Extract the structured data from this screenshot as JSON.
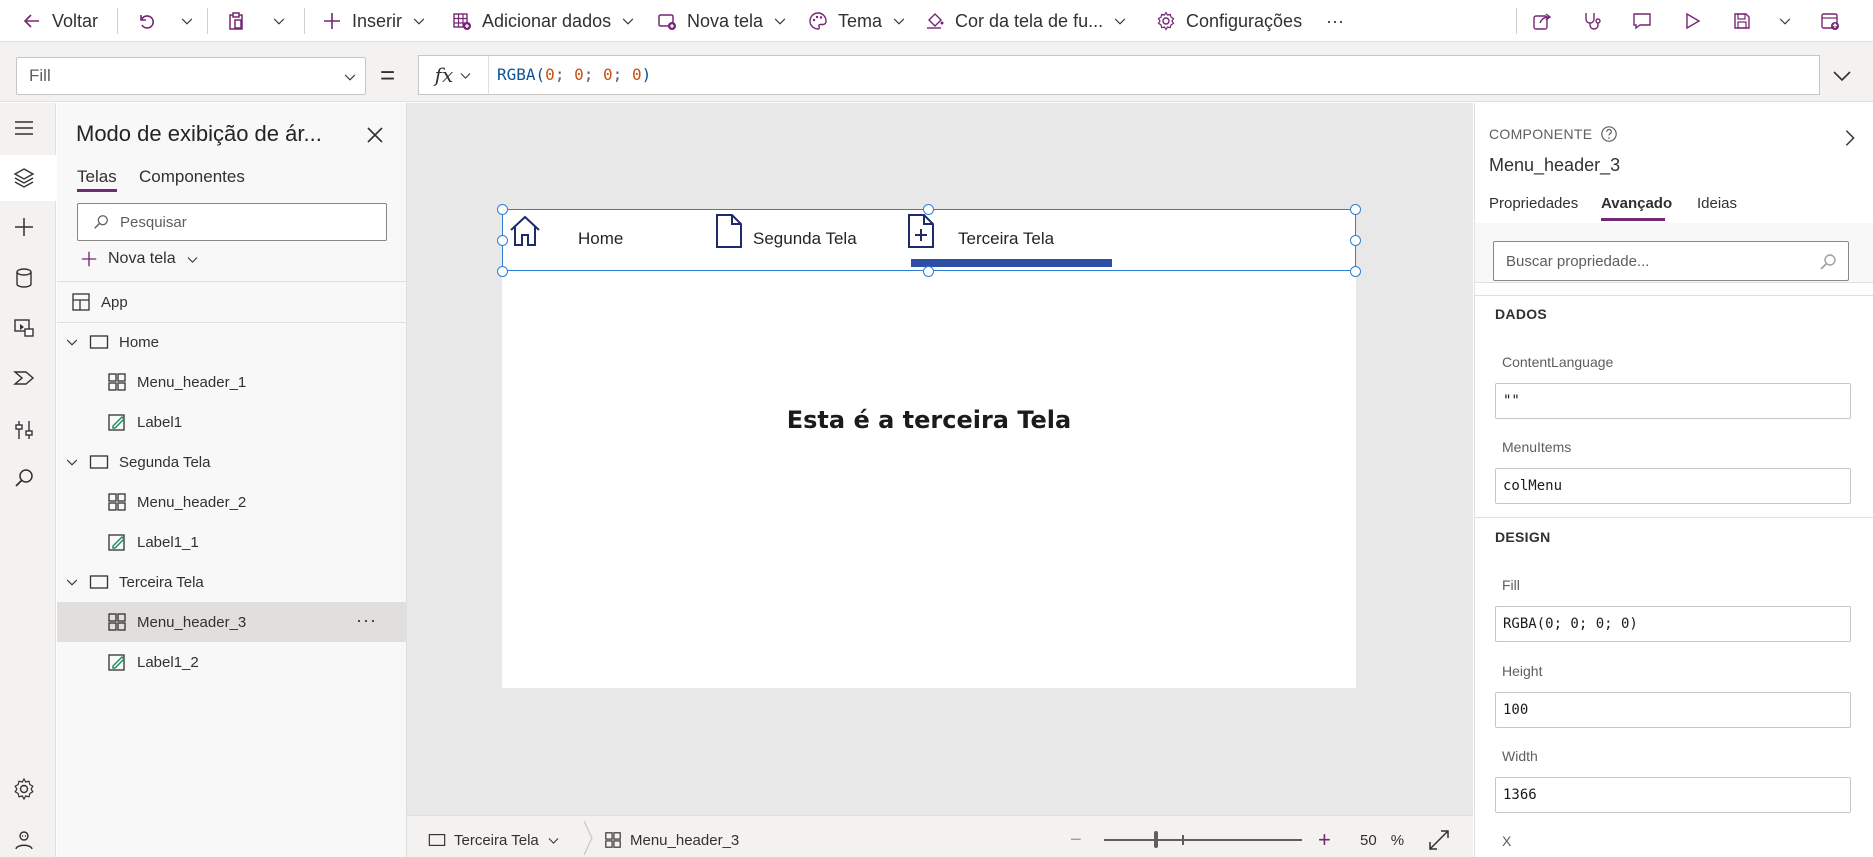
{
  "toolbar": {
    "back": "Voltar",
    "insert": "Inserir",
    "add_data": "Adicionar dados",
    "new_screen": "Nova tela",
    "theme": "Tema",
    "bg_color": "Cor da tela de fu...",
    "settings": "Configurações",
    "more": "···"
  },
  "formula_bar": {
    "property": "Fill",
    "equals": "=",
    "fx": "fx",
    "formula": "RGBA(0; 0; 0; 0)"
  },
  "tree": {
    "title": "Modo de exibição de ár...",
    "tabs": [
      "Telas",
      "Componentes"
    ],
    "search_placeholder": "Pesquisar",
    "new_screen": "Nova tela",
    "nodes": [
      {
        "label": "App"
      },
      {
        "label": "Home"
      },
      {
        "label": "Menu_header_1"
      },
      {
        "label": "Label1"
      },
      {
        "label": "Segunda Tela"
      },
      {
        "label": "Menu_header_2"
      },
      {
        "label": "Label1_1"
      },
      {
        "label": "Terceira Tela"
      },
      {
        "label": "Menu_header_3"
      },
      {
        "label": "Label1_2"
      }
    ]
  },
  "canvas": {
    "menu_items": [
      "Home",
      "Segunda Tela",
      "Terceira Tela"
    ],
    "screen_label": "Esta é a terceira Tela"
  },
  "statusbar": {
    "screen": "Terceira Tela",
    "component": "Menu_header_3",
    "zoom_value": "50",
    "zoom_unit": "%"
  },
  "props": {
    "kicker": "COMPONENTE",
    "name": "Menu_header_3",
    "tabs": [
      "Propriedades",
      "Avançado",
      "Ideias"
    ],
    "search_placeholder": "Buscar propriedade...",
    "sections": {
      "data": "DADOS",
      "design": "DESIGN"
    },
    "fields": {
      "content_language": {
        "label": "ContentLanguage",
        "value": "\"\""
      },
      "menu_items": {
        "label": "MenuItems",
        "value": "colMenu"
      },
      "fill": {
        "label": "Fill",
        "value": "RGBA(0; 0; 0; 0)"
      },
      "height": {
        "label": "Height",
        "value": "100"
      },
      "width": {
        "label": "Width",
        "value": "1366"
      },
      "x": {
        "label": "X"
      }
    }
  },
  "colors": {
    "accent": "#742774",
    "selection": "#2f7fd6",
    "menu_selected": "#2e4ea7",
    "icon_navy": "#1f2a6b"
  }
}
